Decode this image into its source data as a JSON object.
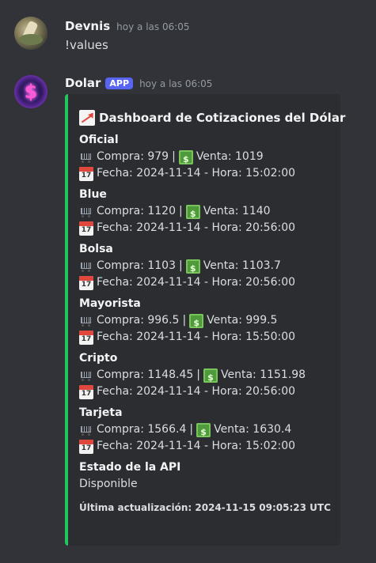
{
  "messages": [
    {
      "username": "Devnis",
      "timestamp": "hoy a las 06:05",
      "content": "!values"
    },
    {
      "username": "Dolar",
      "badge": "APP",
      "timestamp": "hoy a las 06:05"
    }
  ],
  "embed": {
    "accent_color": "#23c55e",
    "title": "Dashboard de Cotizaciones del Dólar",
    "fields": [
      {
        "name": "Oficial",
        "compra": "Compra: 979",
        "venta": "Venta: 1019",
        "fecha": "Fecha: 2024-11-14 - Hora: 15:02:00"
      },
      {
        "name": "Blue",
        "compra": "Compra: 1120",
        "venta": "Venta: 1140",
        "fecha": "Fecha: 2024-11-14 - Hora: 20:56:00"
      },
      {
        "name": "Bolsa",
        "compra": "Compra: 1103",
        "venta": "Venta: 1103.7",
        "fecha": "Fecha: 2024-11-14 - Hora: 20:56:00"
      },
      {
        "name": "Mayorista",
        "compra": "Compra: 996.5",
        "venta": "Venta: 999.5",
        "fecha": "Fecha: 2024-11-14 - Hora: 15:50:00"
      },
      {
        "name": "Cripto",
        "compra": "Compra: 1148.45",
        "venta": "Venta: 1151.98",
        "fecha": "Fecha: 2024-11-14 - Hora: 20:56:00"
      },
      {
        "name": "Tarjeta",
        "compra": "Compra: 1566.4",
        "venta": "Venta: 1630.4",
        "fecha": "Fecha: 2024-11-14 - Hora: 15:02:00"
      }
    ],
    "status": {
      "name": "Estado de la API",
      "value": "Disponible"
    },
    "separator": "|",
    "footer": "Última actualización: 2024-11-15 09:05:23 UTC"
  },
  "icons": {
    "cart": "shopping-cart-icon",
    "money": "dollar-banknote-icon",
    "calendar": "calendar-icon",
    "chart": "chart-increasing-icon"
  }
}
